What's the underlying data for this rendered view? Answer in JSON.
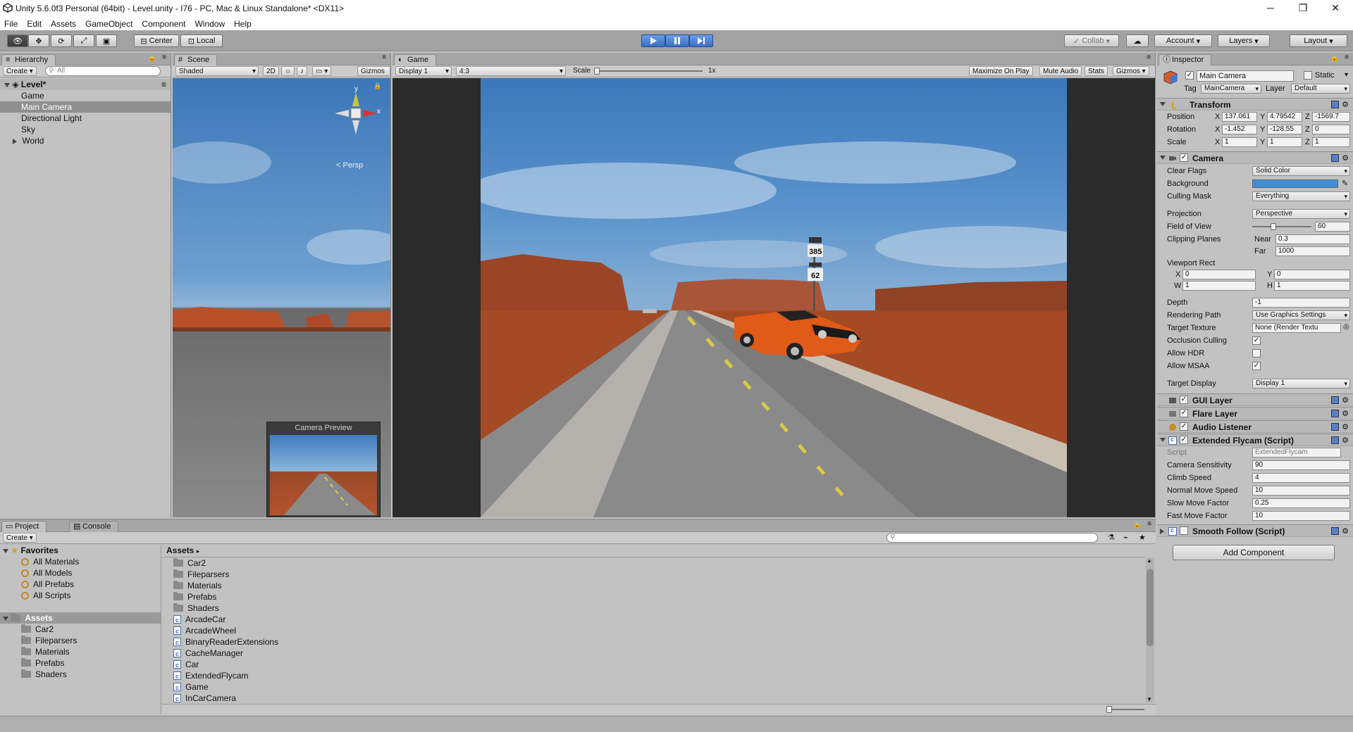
{
  "window": {
    "title": "Unity 5.6.0f3 Personal (64bit) - Level.unity - I76 - PC, Mac & Linux Standalone* <DX11>",
    "minimize": "─",
    "restore": "❐",
    "close": "✕"
  },
  "menu": [
    "File",
    "Edit",
    "Assets",
    "GameObject",
    "Component",
    "Window",
    "Help"
  ],
  "toolbar": {
    "pivot": "Center",
    "space": "Local",
    "collab": "Collab",
    "account": "Account",
    "layers": "Layers",
    "layout": "Layout"
  },
  "hierarchy": {
    "tab": "Hierarchy",
    "create": "Create",
    "search_placeholder": "All",
    "scene": "Level*",
    "items": [
      "Game",
      "Main Camera",
      "Directional Light",
      "Sky",
      "World"
    ]
  },
  "scene": {
    "tab": "Scene",
    "shading": "Shaded",
    "mode2d": "2D",
    "gizmos": "Gizmos",
    "persp": "Persp",
    "camera_preview": "Camera Preview",
    "gizmo_x": "x",
    "gizmo_y": "y"
  },
  "game": {
    "tab": "Game",
    "display": "Display 1",
    "aspect": "4:3",
    "scale_label": "Scale",
    "scale_value": "1x",
    "maximize": "Maximize On Play",
    "mute": "Mute Audio",
    "stats": "Stats",
    "gizmos": "Gizmos",
    "sign_top": "385",
    "sign_bottom": "62"
  },
  "inspector": {
    "tab": "Inspector",
    "object_name": "Main Camera",
    "static_label": "Static",
    "tag_label": "Tag",
    "tag": "MainCamera",
    "layer_label": "Layer",
    "layer": "Default",
    "transform": {
      "title": "Transform",
      "position_label": "Position",
      "rotation_label": "Rotation",
      "scale_label": "Scale",
      "x": "X",
      "y": "Y",
      "z": "Z",
      "position": [
        "137.061",
        "4.79542",
        "-1569.7"
      ],
      "rotation": [
        "-1.452",
        "-128.55",
        "0"
      ],
      "scale": [
        "1",
        "1",
        "1"
      ]
    },
    "camera": {
      "title": "Camera",
      "clear_flags_label": "Clear Flags",
      "clear_flags": "Solid Color",
      "background_label": "Background",
      "background_color": "#3c8fd6",
      "culling_label": "Culling Mask",
      "culling": "Everything",
      "projection_label": "Projection",
      "projection": "Perspective",
      "fov_label": "Field of View",
      "fov": "60",
      "fov_fraction": 0.33,
      "clipping_label": "Clipping Planes",
      "near_label": "Near",
      "near": "0.3",
      "far_label": "Far",
      "far": "1000",
      "viewport_label": "Viewport Rect",
      "vx_label": "X",
      "vy_label": "Y",
      "vw_label": "W",
      "vh_label": "H",
      "vx": "0",
      "vy": "0",
      "vw": "1",
      "vh": "1",
      "depth_label": "Depth",
      "depth": "-1",
      "rendering_label": "Rendering Path",
      "rendering": "Use Graphics Settings",
      "target_texture_label": "Target Texture",
      "target_texture": "None (Render Textu",
      "occlusion_label": "Occlusion Culling",
      "hdr_label": "Allow HDR",
      "msaa_label": "Allow MSAA",
      "target_display_label": "Target Display",
      "target_display": "Display 1"
    },
    "gui_layer": "GUI Layer",
    "flare_layer": "Flare Layer",
    "audio_listener": "Audio Listener",
    "flycam": {
      "title": "Extended Flycam (Script)",
      "script_label": "Script",
      "script": "ExtendedFlycam",
      "sensitivity_label": "Camera Sensitivity",
      "sensitivity": "90",
      "climb_label": "Climb Speed",
      "climb": "4",
      "normal_label": "Normal Move Speed",
      "normal": "10",
      "slow_label": "Slow Move Factor",
      "slow": "0.25",
      "fast_label": "Fast Move Factor",
      "fast": "10"
    },
    "smooth_follow": "Smooth Follow (Script)",
    "add_component": "Add Component",
    "check": "✓"
  },
  "project": {
    "tab": "Project",
    "console_tab": "Console",
    "create": "Create",
    "favorites_label": "Favorites",
    "favorites": [
      "All Materials",
      "All Models",
      "All Prefabs",
      "All Scripts"
    ],
    "assets_label": "Assets",
    "asset_folders": [
      "Car2",
      "Fileparsers",
      "Materials",
      "Prefabs",
      "Shaders"
    ],
    "breadcrumb": "Assets",
    "files": [
      {
        "name": "Car2",
        "type": "folder"
      },
      {
        "name": "Fileparsers",
        "type": "folder"
      },
      {
        "name": "Materials",
        "type": "folder"
      },
      {
        "name": "Prefabs",
        "type": "folder"
      },
      {
        "name": "Shaders",
        "type": "folder"
      },
      {
        "name": "ArcadeCar",
        "type": "script"
      },
      {
        "name": "ArcadeWheel",
        "type": "script"
      },
      {
        "name": "BinaryReaderExtensions",
        "type": "script"
      },
      {
        "name": "CacheManager",
        "type": "script"
      },
      {
        "name": "Car",
        "type": "script"
      },
      {
        "name": "ExtendedFlycam",
        "type": "script"
      },
      {
        "name": "Game",
        "type": "script"
      },
      {
        "name": "InCarCamera",
        "type": "script"
      }
    ]
  }
}
